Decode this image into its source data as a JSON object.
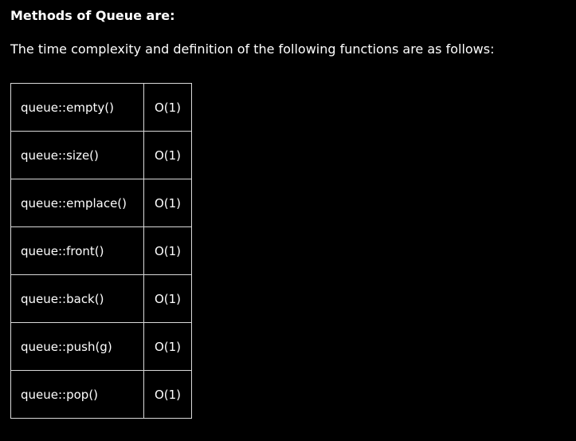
{
  "heading": "Methods of Queue are:",
  "intro": "The time complexity and definition of the following functions are as follows:",
  "rows": [
    {
      "method": "queue::empty()",
      "complexity": "O(1)"
    },
    {
      "method": "queue::size()",
      "complexity": "O(1)"
    },
    {
      "method": "queue::emplace()",
      "complexity": "O(1)"
    },
    {
      "method": "queue::front()",
      "complexity": "O(1)"
    },
    {
      "method": "queue::back()",
      "complexity": "O(1)"
    },
    {
      "method": "queue::push(g)",
      "complexity": "O(1)"
    },
    {
      "method": "queue::pop()",
      "complexity": "O(1)"
    }
  ],
  "colors": {
    "background": "#000000",
    "text": "#ffffff",
    "border": "#d9d9d9"
  }
}
